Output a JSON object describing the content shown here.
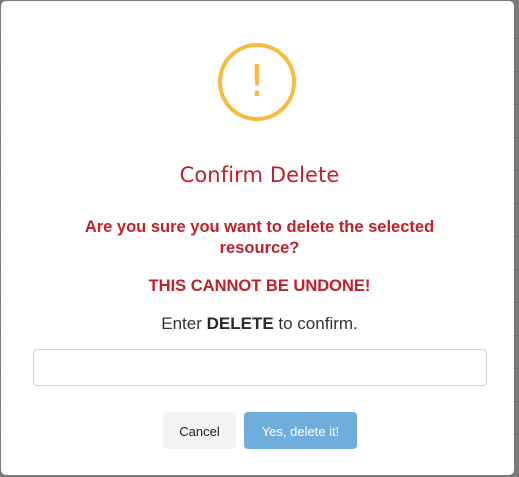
{
  "dialog": {
    "icon": "warning-exclamation-icon",
    "icon_glyph": "!",
    "icon_color": "#f8bb3a",
    "title": "Confirm Delete",
    "question": "Are you sure you want to delete the selected resource?",
    "warning": "THIS CANNOT BE UNDONE!",
    "instruction_prefix": "Enter",
    "instruction_keyword": "DELETE",
    "instruction_suffix": "to confirm.",
    "input_value": "",
    "input_placeholder": "",
    "cancel_label": "Cancel",
    "confirm_label": "Yes, delete it!",
    "accent_color": "#c0202a",
    "confirm_button_color": "#6faedc"
  }
}
